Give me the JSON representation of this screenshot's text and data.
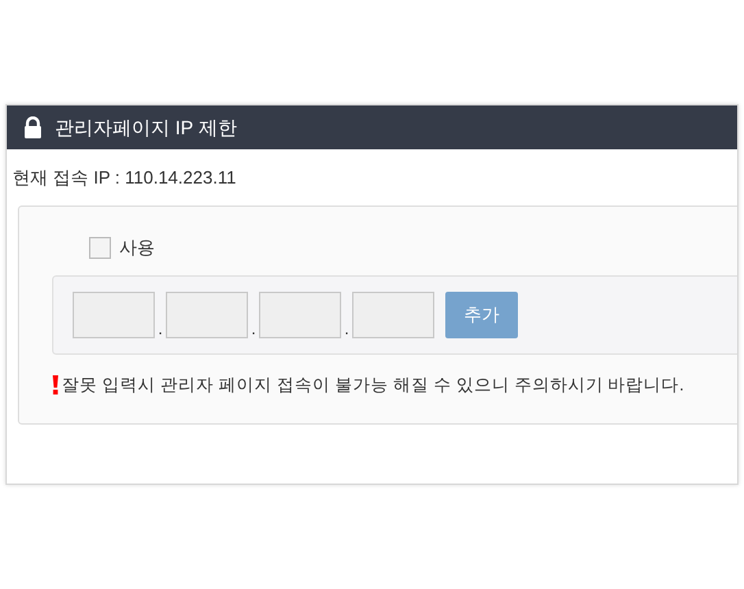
{
  "panel": {
    "title": "관리자페이지 IP 제한"
  },
  "current_ip": "현재 접속 IP : 110.14.223.11",
  "use_checkbox": {
    "label": "사용",
    "checked": false
  },
  "ip_fields": [
    {
      "kind": "octet"
    },
    {
      "kind": "octet"
    },
    {
      "kind": "octet"
    },
    {
      "kind": "octet"
    }
  ],
  "separators": [
    ".",
    ".",
    "."
  ],
  "add_button": "추가",
  "warning": "잘못 입력시 관리자 페이지 접속이 불가능 해질 수 있으니 주의하시기 바랍니다."
}
